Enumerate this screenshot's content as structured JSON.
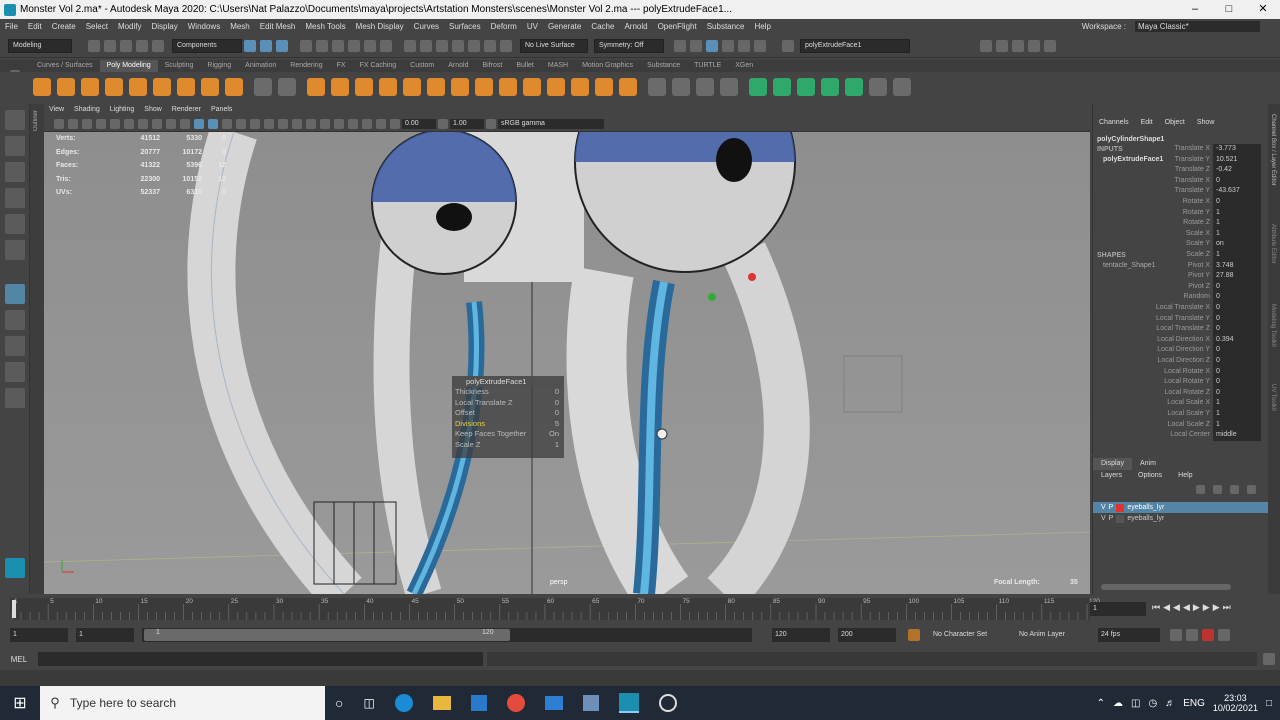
{
  "titlebar": {
    "title": "Monster Vol 2.ma* - Autodesk Maya 2020: C:\\Users\\Nat Palazzo\\Documents\\maya\\projects\\Artstation Monsters\\scenes\\Monster Vol 2.ma  ---  polyExtrudeFace1..."
  },
  "menubar": {
    "items": [
      "File",
      "Edit",
      "Create",
      "Select",
      "Modify",
      "Display",
      "Windows",
      "Mesh",
      "Edit Mesh",
      "Mesh Tools",
      "Mesh Display",
      "Curves",
      "Surfaces",
      "Deform",
      "UV",
      "Generate",
      "Cache",
      "Arnold",
      "OpenFlight",
      "Substance",
      "Help"
    ],
    "workspace_label": "Workspace :",
    "workspace_value": "Maya Classic*"
  },
  "statusline": {
    "mode": "Modeling",
    "components": "Components",
    "no_live_surface": "No Live Surface",
    "symmetry": "Symmetry: Off",
    "node_field": "polyExtrudeFace1"
  },
  "shelf_tabs": [
    "Curves / Surfaces",
    "Poly Modeling",
    "Sculpting",
    "Rigging",
    "Animation",
    "Rendering",
    "FX",
    "FX Caching",
    "Custom",
    "Arnold",
    "Bifrost",
    "Bullet",
    "MASH",
    "Motion Graphics",
    "Substance",
    "TURTLE",
    "XGen"
  ],
  "shelf_active": "Poly Modeling",
  "viewport": {
    "menu": [
      "View",
      "Shading",
      "Lighting",
      "Show",
      "Renderer",
      "Panels"
    ],
    "exposure": "0.00",
    "gamma": "1.00",
    "colorspace": "sRGB gamma",
    "hud": [
      {
        "label": "Verts:",
        "a": "41512",
        "b": "5330",
        "c": "0"
      },
      {
        "label": "Edges:",
        "a": "20777",
        "b": "10172",
        "c": "0"
      },
      {
        "label": "Faces:",
        "a": "41322",
        "b": "5396",
        "c": "12"
      },
      {
        "label": "Tris:",
        "a": "22300",
        "b": "10152",
        "c": "12"
      },
      {
        "label": "UVs:",
        "a": "52337",
        "b": "6310",
        "c": "0"
      }
    ],
    "persp_label": "persp",
    "focal_label": "Focal Length:",
    "focal_value": "35"
  },
  "extrude_popup": {
    "title": "polyExtrudeFace1",
    "rows": [
      {
        "label": "Thickness",
        "value": "0",
        "highlight": false
      },
      {
        "label": "Local Translate Z",
        "value": "0",
        "highlight": false
      },
      {
        "label": "Offset",
        "value": "0",
        "highlight": false
      },
      {
        "label": "Divisions",
        "value": "5",
        "highlight": true
      },
      {
        "label": "Keep Faces Together",
        "value": "On",
        "highlight": false
      },
      {
        "label": "Scale Z",
        "value": "1",
        "highlight": false
      }
    ]
  },
  "channel_box": {
    "menu": [
      "Channels",
      "Edit",
      "Object",
      "Show"
    ],
    "object": "polyCylinderShape1",
    "inputs_label": "INPUTS",
    "input_node": "polyExtrudeFace1",
    "shapes_label": "SHAPES",
    "shape_node": "tentacle_Shape1",
    "rows": [
      {
        "l": "Translate X",
        "v": "-3.773"
      },
      {
        "l": "Translate Y",
        "v": "10.521"
      },
      {
        "l": "Translate Z",
        "v": "-0.42"
      },
      {
        "l": "Translate X",
        "v": "0"
      },
      {
        "l": "Translate Y",
        "v": "-43.637"
      },
      {
        "l": "Rotate X",
        "v": "0"
      },
      {
        "l": "Rotate Y",
        "v": "1"
      },
      {
        "l": "Rotate Z",
        "v": "1"
      },
      {
        "l": "Scale X",
        "v": "1"
      },
      {
        "l": "Scale Y",
        "v": "on"
      },
      {
        "l": "Scale Z",
        "v": "1"
      },
      {
        "l": "Pivot X",
        "v": "3.748"
      },
      {
        "l": "Pivot Y",
        "v": "27.88"
      },
      {
        "l": "Pivot Z",
        "v": "0"
      },
      {
        "l": "Random",
        "v": "0"
      },
      {
        "l": "Local Translate X",
        "v": "0"
      },
      {
        "l": "Local Translate Y",
        "v": "0"
      },
      {
        "l": "Local Translate Z",
        "v": "0"
      },
      {
        "l": "Local Direction X",
        "v": "0.394"
      },
      {
        "l": "Local Direction Y",
        "v": "0"
      },
      {
        "l": "Local Direction Z",
        "v": "0"
      },
      {
        "l": "Local Rotate X",
        "v": "0"
      },
      {
        "l": "Local Rotate Y",
        "v": "0"
      },
      {
        "l": "Local Rotate Z",
        "v": "0"
      },
      {
        "l": "Local Scale X",
        "v": "1"
      },
      {
        "l": "Local Scale Y",
        "v": "1"
      },
      {
        "l": "Local Scale Z",
        "v": "1"
      },
      {
        "l": "Local Center",
        "v": "middle"
      }
    ]
  },
  "side_tabs": [
    "Channel Box / Layer Editor",
    "Attribute Editor",
    "Modeling Toolkit",
    "UV Toolkit"
  ],
  "layer_editor": {
    "tabs": [
      "Display",
      "Anim"
    ],
    "menu": [
      "Layers",
      "Options",
      "Help"
    ],
    "layers": [
      {
        "v": "V",
        "p": "P",
        "name": "eyeballs_lyr",
        "selected": true
      },
      {
        "v": "V",
        "p": "P",
        "name": "eyeballs_lyr",
        "selected": false
      }
    ]
  },
  "timeslider": {
    "ticks": [
      "1",
      "5",
      "10",
      "15",
      "20",
      "25",
      "30",
      "35",
      "40",
      "45",
      "50",
      "55",
      "60",
      "65",
      "70",
      "75",
      "80",
      "85",
      "90",
      "95",
      "100",
      "105",
      "110",
      "115",
      "120"
    ],
    "current": "1"
  },
  "range": {
    "start": "1",
    "start2": "1",
    "slider_start": "1",
    "slider_end": "120",
    "end": "120",
    "end2": "200",
    "character_set": "No Character Set",
    "anim_layer": "No Anim Layer",
    "fps": "24 fps"
  },
  "cmdline": {
    "label": "MEL"
  },
  "taskbar": {
    "search_placeholder": "Type here to search",
    "lang": "ENG",
    "time": "23:03",
    "date": "10/02/2021"
  }
}
